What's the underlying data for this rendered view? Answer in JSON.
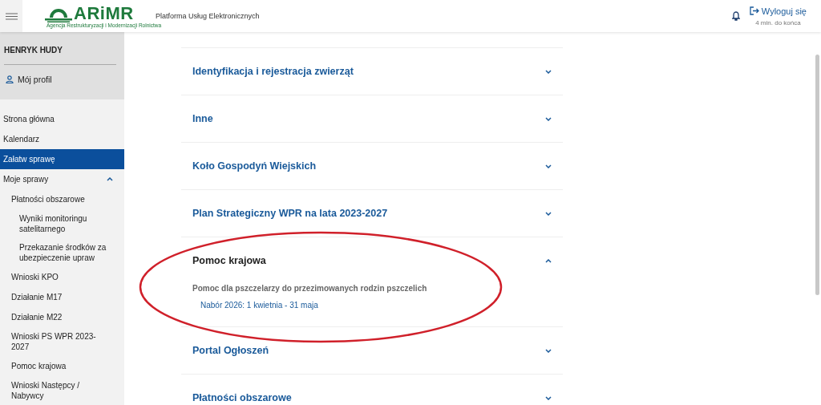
{
  "header": {
    "logo": "ARiMR",
    "logo_subtitle": "Agencja Restrukturyzacji i Modernizacji Rolnictwa",
    "platform": "Platforma Usług Elektronicznych",
    "logout": "Wyloguj się",
    "session": "4 min. do końca"
  },
  "user": {
    "name": "HENRYK HUDY",
    "profile": "Mój profil"
  },
  "sidebar": {
    "items": [
      {
        "label": "Strona główna",
        "selected": false
      },
      {
        "label": "Kalendarz",
        "selected": false
      },
      {
        "label": "Załatw sprawę",
        "selected": true
      },
      {
        "label": "Moje sprawy",
        "selected": false,
        "expanded": true,
        "children": [
          {
            "label": "Płatności obszarowe",
            "selected": false,
            "children": [
              {
                "label": "Wyniki monitoringu satelitarnego",
                "selected": false
              },
              {
                "label": "Przekazanie środków za ubezpieczenie upraw",
                "selected": false
              }
            ]
          },
          {
            "label": "Wnioski KPO",
            "selected": false
          },
          {
            "label": "Działanie M17",
            "selected": false
          },
          {
            "label": "Działanie M22",
            "selected": false
          },
          {
            "label": "Wnioski PS WPR 2023-2027",
            "selected": false
          },
          {
            "label": "Pomoc krajowa",
            "selected": false
          },
          {
            "label": "Wnioski Następcy / Nabywcy",
            "selected": false
          }
        ]
      }
    ]
  },
  "accordion": [
    {
      "title": "Identyfikacja i rejestracja zwierząt",
      "expanded": false
    },
    {
      "title": "Inne",
      "expanded": false
    },
    {
      "title": "Koło Gospodyń Wiejskich",
      "expanded": false
    },
    {
      "title": "Plan Strategiczny WPR na lata 2023-2027",
      "expanded": false
    },
    {
      "title": "Pomoc krajowa",
      "expanded": true,
      "sections": [
        {
          "subtitle": "Pomoc dla pszczelarzy do przezimowanych rodzin pszczelich",
          "links": [
            "Nabór 2026: 1 kwietnia - 31 maja"
          ]
        }
      ]
    },
    {
      "title": "Portal Ogłoszeń",
      "expanded": false
    },
    {
      "title": "Płatności obszarowe",
      "expanded": false
    }
  ],
  "annotation": {
    "kind": "ellipse",
    "color": "#d0202a"
  }
}
